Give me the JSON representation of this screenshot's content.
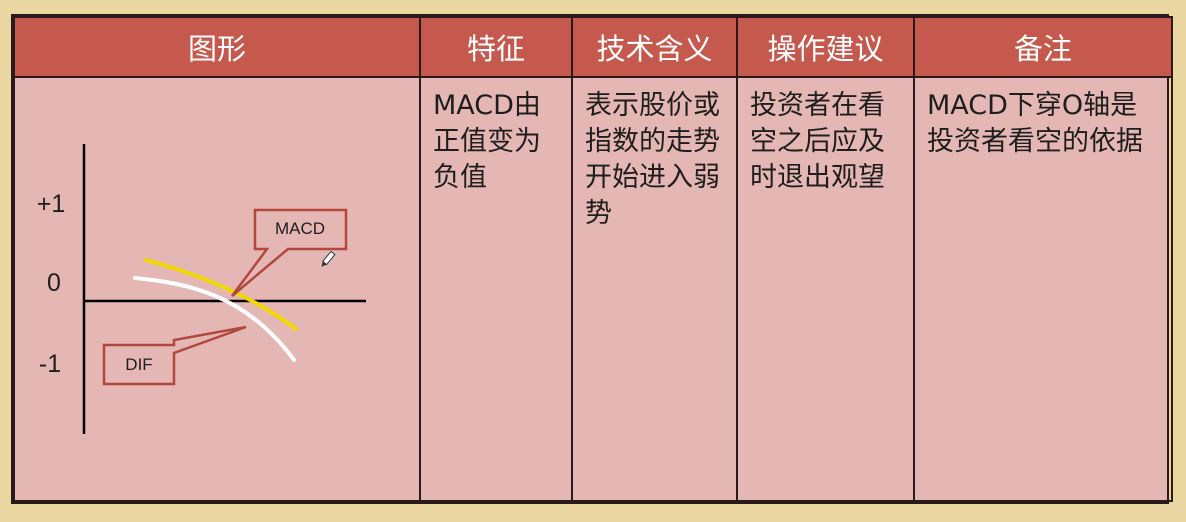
{
  "headers": {
    "graph": "图形",
    "feature": "特征",
    "meaning": "技术含义",
    "advice": "操作建议",
    "note": "备注"
  },
  "row": {
    "feature": "MACD由正值变为负值",
    "meaning": "表示股价或指数的走势开始进入弱势",
    "advice": "投资者在看空之后应及时退出观望",
    "note": "MACD下穿O轴是投资者看空的依据"
  },
  "diagram": {
    "y_labels": {
      "plus_one": "+1",
      "zero": "0",
      "minus_one": "-1"
    },
    "callouts": {
      "macd": "MACD",
      "dif": "DIF"
    },
    "colors": {
      "macd_line": "#f0d800",
      "dif_line": "#ffffff",
      "callout_border": "#b2473c",
      "axis": "#000000"
    },
    "cursor_icon": "pen-cursor-icon"
  },
  "colors": {
    "background": "#e9d6a0",
    "header_fill": "#c5594d",
    "cell_fill": "#e4b7b4",
    "border": "#2a1a1a"
  }
}
